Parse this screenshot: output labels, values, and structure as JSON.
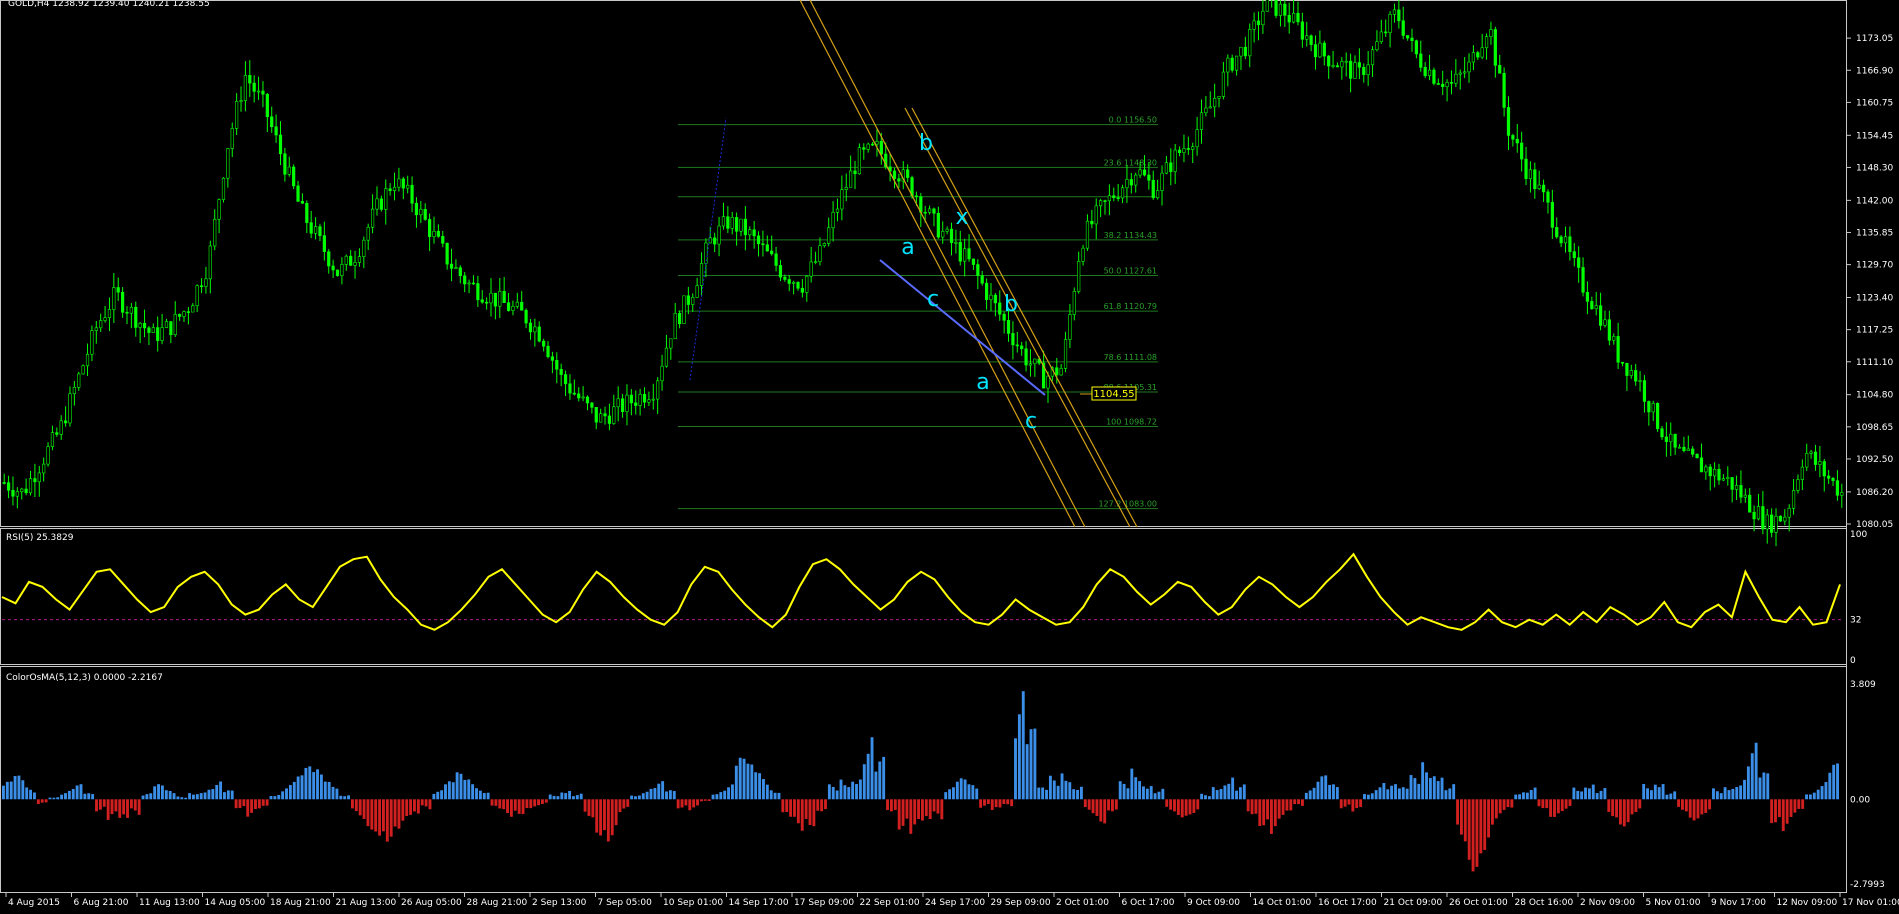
{
  "header": {
    "title": "GOLD,H4 1238.92 1239.40 1240.21 1238.55"
  },
  "colors": {
    "background": "#000000",
    "candle": "#00ff00",
    "fib": "#1f7a1f",
    "channel": "#d4a017",
    "trendline": "#5a6bff",
    "wave_label": "#00e5ff",
    "rsi_line": "#ffff00",
    "rsi_level": "#b01a8a",
    "osma_positive": "#3b8fe8",
    "osma_negative": "#d22020",
    "axis_text": "#ffffff",
    "price_tag_bg": "#ffff00"
  },
  "price_panel": {
    "y_ticks": [
      "1173.05",
      "1166.90",
      "1160.75",
      "1154.45",
      "1148.30",
      "1142.00",
      "1135.85",
      "1129.70",
      "1123.40",
      "1117.25",
      "1111.10",
      "1104.80",
      "1098.65",
      "1092.50",
      "1086.20",
      "1080.05"
    ],
    "current_price_tag": "1104.55",
    "fib_levels": [
      {
        "label": "0.0 1156.50",
        "price": 1156.5
      },
      {
        "label": "23.6 1148.30",
        "price": 1148.3
      },
      {
        "label": "",
        "price": 1142.7
      },
      {
        "label": "38.2 1134.43",
        "price": 1134.43
      },
      {
        "label": "50.0 1127.61",
        "price": 1127.61
      },
      {
        "label": "61.8 1120.79",
        "price": 1120.79
      },
      {
        "label": "78.6 1111.08",
        "price": 1111.08
      },
      {
        "label": "88.6 1105.31",
        "price": 1105.31
      },
      {
        "label": "100 1098.72",
        "price": 1098.72
      },
      {
        "label": "127.2 1083.00",
        "price": 1083.0
      }
    ],
    "wave_labels": [
      "b",
      "x",
      "a",
      "c",
      "b",
      "a",
      "c"
    ],
    "price_series_sampled": [
      1088,
      1086,
      1092,
      1098,
      1108,
      1118,
      1124,
      1120,
      1116,
      1118,
      1122,
      1130,
      1152,
      1166,
      1160,
      1150,
      1140,
      1134,
      1128,
      1132,
      1140,
      1146,
      1142,
      1136,
      1130,
      1126,
      1124,
      1122,
      1120,
      1116,
      1108,
      1104,
      1100,
      1102,
      1104,
      1106,
      1118,
      1124,
      1134,
      1138,
      1136,
      1132,
      1128,
      1126,
      1132,
      1142,
      1150,
      1152,
      1148,
      1144,
      1138,
      1134,
      1130,
      1124,
      1118,
      1112,
      1108,
      1110,
      1134,
      1140,
      1144,
      1148,
      1144,
      1150,
      1154,
      1160,
      1168,
      1172,
      1180,
      1178,
      1174,
      1170,
      1168,
      1166,
      1172,
      1178,
      1170,
      1166,
      1164,
      1168,
      1176,
      1156,
      1148,
      1142,
      1134,
      1126,
      1120,
      1112,
      1108,
      1100,
      1094,
      1092,
      1090,
      1088,
      1084,
      1080,
      1082,
      1094,
      1090,
      1086
    ]
  },
  "rsi_panel": {
    "label": "RSI(5) 25.3829",
    "y_ticks": [
      "100",
      "32",
      "0"
    ],
    "level": 32,
    "values": [
      50,
      45,
      62,
      58,
      48,
      40,
      55,
      70,
      72,
      60,
      48,
      38,
      42,
      58,
      66,
      70,
      60,
      44,
      36,
      40,
      52,
      60,
      48,
      42,
      58,
      74,
      80,
      82,
      64,
      50,
      40,
      28,
      24,
      30,
      40,
      52,
      66,
      72,
      60,
      48,
      36,
      30,
      38,
      56,
      70,
      62,
      50,
      40,
      32,
      28,
      38,
      60,
      74,
      70,
      56,
      44,
      34,
      26,
      36,
      58,
      76,
      80,
      72,
      60,
      50,
      40,
      48,
      62,
      70,
      64,
      50,
      38,
      30,
      28,
      36,
      48,
      40,
      34,
      28,
      30,
      42,
      60,
      72,
      66,
      54,
      44,
      52,
      62,
      58,
      46,
      36,
      42,
      56,
      66,
      60,
      50,
      42,
      50,
      62,
      72,
      84,
      66,
      50,
      38,
      28,
      34,
      30,
      26,
      24,
      30,
      40,
      30,
      26,
      32,
      28,
      36,
      28,
      38,
      30,
      42,
      36,
      28,
      34,
      46,
      30,
      26,
      38,
      44,
      34,
      70,
      50,
      32,
      30,
      42,
      28,
      30,
      60
    ]
  },
  "osma_panel": {
    "label": "ColorOsMA(5,12,3) 0.0000 -2.2167",
    "y_ticks": [
      "3.809",
      "0.00",
      "-2.7993"
    ],
    "values": [
      0.6,
      0.8,
      0.4,
      -0.2,
      0.1,
      0.3,
      0.5,
      0.2,
      -0.4,
      -0.8,
      -1.0,
      -0.6,
      0.2,
      0.5,
      0.3,
      0.1,
      0.3,
      0.4,
      0.6,
      0.3,
      -0.3,
      -0.6,
      -0.4,
      0.2,
      0.5,
      0.8,
      1.1,
      1.0,
      0.7,
      0.2,
      -0.6,
      -1.0,
      -1.2,
      -1.4,
      -1.1,
      -0.8,
      -0.4,
      0.3,
      0.6,
      0.9,
      0.7,
      0.4,
      -0.4,
      -0.6,
      -0.5,
      -0.3,
      -0.2,
      0.2,
      0.4,
      0.2,
      -0.6,
      -1.2,
      -1.4,
      -0.5,
      0.2,
      0.4,
      0.6,
      0.3,
      -0.3,
      -0.4,
      -0.1,
      0.3,
      0.5,
      1.4,
      1.2,
      0.9,
      0.4,
      -0.8,
      -1.1,
      -0.9,
      -0.4,
      0.5,
      0.8,
      1.0,
      2.3,
      1.4,
      -0.4,
      -1.0,
      -1.3,
      -1.1,
      -0.8,
      0.4,
      0.7,
      0.5,
      -0.3,
      -0.5,
      -0.3,
      3.7,
      2.4,
      0.4,
      0.8,
      1.1,
      0.6,
      -0.5,
      -0.8,
      -0.4,
      0.6,
      1.2,
      0.7,
      0.4,
      -0.4,
      -0.6,
      -0.5,
      0.2,
      0.6,
      0.9,
      0.5,
      -0.5,
      -0.9,
      -1.2,
      -0.7,
      -0.3,
      0.4,
      0.8,
      0.5,
      -0.3,
      -0.5,
      0.3,
      0.6,
      0.5,
      0.4,
      0.8,
      1.4,
      1.2,
      0.6,
      -1.4,
      -2.4,
      -1.8,
      -0.9,
      -0.5,
      0.3,
      0.4,
      -0.3,
      -0.6,
      -0.4,
      0.5,
      0.7,
      0.4,
      -0.6,
      -0.9,
      -0.5,
      0.6,
      0.8,
      0.3,
      -0.4,
      -0.7,
      -0.5,
      0.4,
      0.6,
      0.8,
      1.9,
      0.9,
      -0.8,
      -1.1,
      -0.6,
      0.3,
      0.6,
      1.2
    ]
  },
  "time_axis": [
    "4 Aug 2015",
    "6 Aug 21:00",
    "11 Aug 13:00",
    "14 Aug 05:00",
    "18 Aug 21:00",
    "21 Aug 13:00",
    "26 Aug 05:00",
    "28 Aug 21:00",
    "2 Sep 13:00",
    "7 Sep 05:00",
    "10 Sep 01:00",
    "14 Sep 17:00",
    "17 Sep 09:00",
    "22 Sep 01:00",
    "24 Sep 17:00",
    "29 Sep 09:00",
    "2 Oct 01:00",
    "6 Oct 17:00",
    "9 Oct 09:00",
    "14 Oct 01:00",
    "16 Oct 17:00",
    "21 Oct 09:00",
    "26 Oct 01:00",
    "28 Oct 16:00",
    "2 Nov 09:00",
    "5 Nov 01:00",
    "9 Nov 17:00",
    "12 Nov 09:00",
    "17 Nov 01:00"
  ],
  "chart_data": [
    {
      "type": "line",
      "title": "GOLD,H4 1238.92 1239.40 1240.21 1238.55",
      "xlabel": "",
      "ylabel": "",
      "ylim": [
        1080.05,
        1179.2
      ],
      "x": [
        "4 Aug 2015",
        "6 Aug 21:00",
        "11 Aug 13:00",
        "14 Aug 05:00",
        "18 Aug 21:00",
        "21 Aug 13:00",
        "26 Aug 05:00",
        "28 Aug 21:00",
        "2 Sep 13:00",
        "7 Sep 05:00",
        "10 Sep 01:00",
        "14 Sep 17:00",
        "17 Sep 09:00",
        "22 Sep 01:00",
        "24 Sep 17:00",
        "29 Sep 09:00",
        "2 Oct 01:00",
        "6 Oct 17:00",
        "9 Oct 09:00",
        "14 Oct 01:00",
        "16 Oct 17:00",
        "21 Oct 09:00",
        "26 Oct 01:00",
        "28 Oct 16:00",
        "2 Nov 09:00",
        "5 Nov 01:00",
        "9 Nov 17:00",
        "12 Nov 09:00",
        "17 Nov 01:00"
      ],
      "grid": false
    },
    {
      "type": "line",
      "title": "RSI(5) 25.3829",
      "ylim": [
        0,
        100
      ],
      "levels": [
        32
      ]
    },
    {
      "type": "bar",
      "title": "ColorOsMA(5,12,3) 0.0000 -2.2167",
      "ylim": [
        -2.7993,
        3.809
      ]
    }
  ]
}
